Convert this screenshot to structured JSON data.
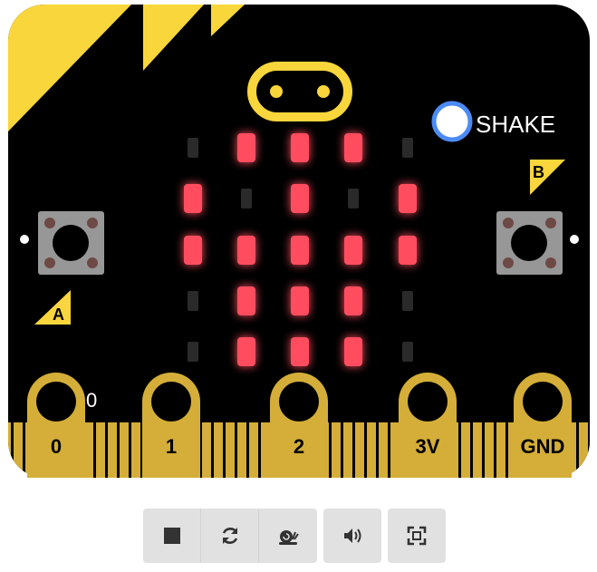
{
  "colors": {
    "board": "#000000",
    "accent": "#f9d63b",
    "pin_gold": "#d4ae38",
    "led_on": "#ff4d5e",
    "led_off": "#2a2a2a",
    "button_body": "#979797",
    "shake_ring": "#4c8bf5"
  },
  "shake": {
    "label": "SHAKE",
    "icon": "circle-indicator-icon"
  },
  "buttons": {
    "a_label": "A",
    "b_label": "B"
  },
  "pins": [
    {
      "label": "0"
    },
    {
      "label": "1"
    },
    {
      "label": "2"
    },
    {
      "label": "3V"
    },
    {
      "label": "GND"
    }
  ],
  "pin0_value": "0",
  "led_matrix": [
    [
      0,
      1,
      1,
      1,
      0
    ],
    [
      1,
      0,
      1,
      0,
      1
    ],
    [
      1,
      1,
      1,
      1,
      1
    ],
    [
      0,
      1,
      1,
      1,
      0
    ],
    [
      0,
      1,
      1,
      1,
      0
    ]
  ],
  "controls": [
    {
      "name": "stop-button",
      "icon": "stop-icon"
    },
    {
      "name": "restart-button",
      "icon": "refresh-icon"
    },
    {
      "name": "slow-mode-button",
      "icon": "snail-icon"
    },
    {
      "name": "mute-button",
      "icon": "volume-icon"
    },
    {
      "name": "fullscreen-button",
      "icon": "fullscreen-icon"
    }
  ]
}
